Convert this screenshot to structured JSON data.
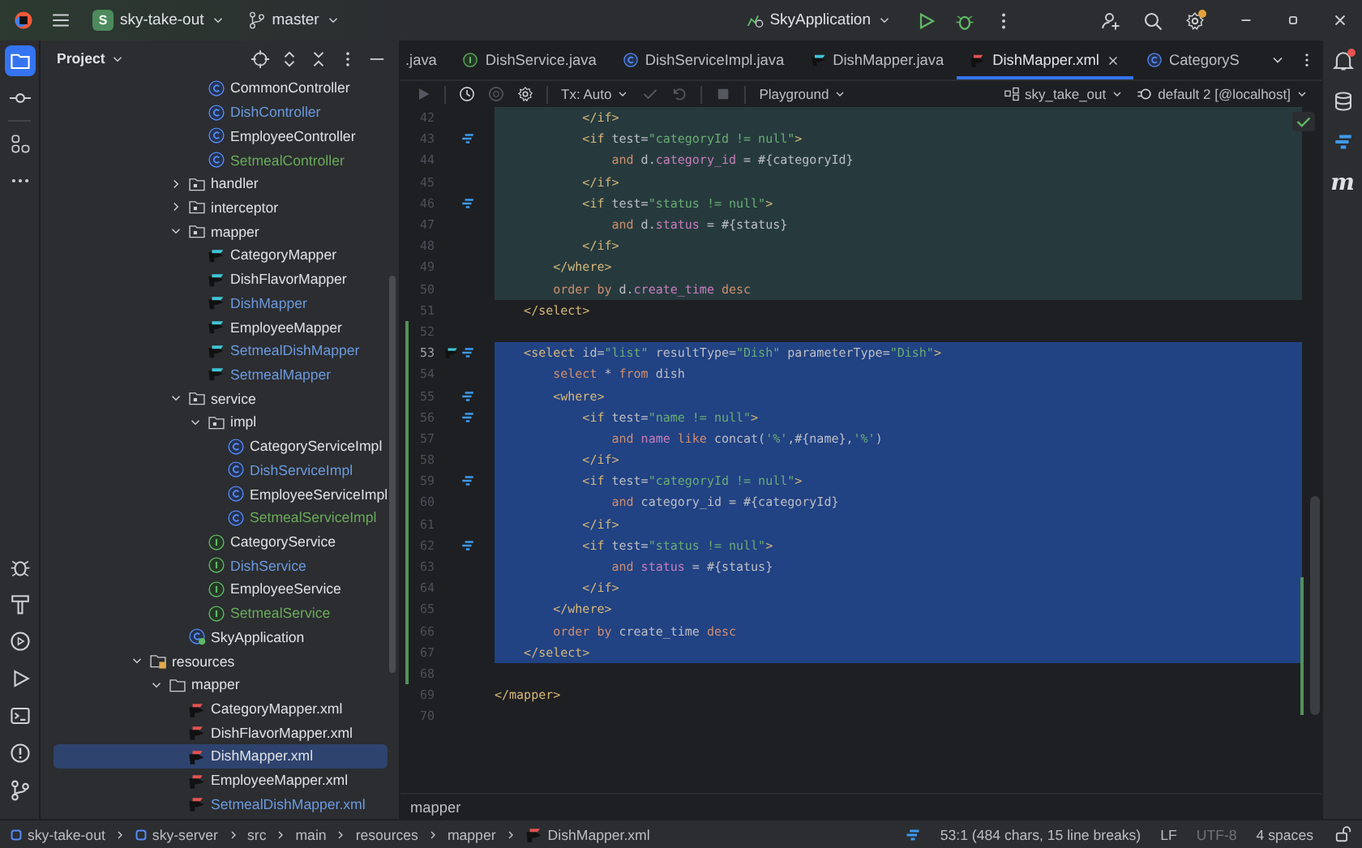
{
  "title_bar": {
    "project_badge": "S",
    "project": "sky-take-out",
    "branch": "master",
    "run_config": "SkyApplication",
    "settings_badge": true
  },
  "left_tools": [
    {
      "kind": "project",
      "selected": true
    },
    {
      "kind": "commit",
      "selected": false
    },
    {
      "kind": "structure",
      "selected": false
    },
    {
      "kind": "more",
      "selected": false
    }
  ],
  "left_tools_bottom": [
    {
      "kind": "debug"
    },
    {
      "kind": "build"
    },
    {
      "kind": "services"
    },
    {
      "kind": "run"
    },
    {
      "kind": "terminal"
    },
    {
      "kind": "problems"
    },
    {
      "kind": "git"
    }
  ],
  "project_panel": {
    "title": "Project",
    "tree": [
      {
        "children": [
          {
            "children": [
              {
                "children": [
                  {
                    "label": "CommonController",
                    "kind": "class",
                    "color": "#dfe1e5",
                    "selected": false
                  },
                  {
                    "label": "DishController",
                    "kind": "class",
                    "color": "#6b9ae0",
                    "selected": false
                  },
                  {
                    "label": "EmployeeController",
                    "kind": "class",
                    "color": "#dfe1e5",
                    "selected": false
                  },
                  {
                    "label": "SetmealController",
                    "kind": "class",
                    "color": "#6aab5b",
                    "selected": false
                  }
                ]
              },
              {
                "label": "handler",
                "kind": "package",
                "expanded": false,
                "selected": false
              },
              {
                "label": "interceptor",
                "kind": "package",
                "expanded": false,
                "selected": false
              },
              {
                "label": "mapper",
                "kind": "package",
                "expanded": true,
                "selected": false,
                "children": [
                  {
                    "label": "CategoryMapper",
                    "kind": "mapper",
                    "color": "#dfe1e5",
                    "selected": false
                  },
                  {
                    "label": "DishFlavorMapper",
                    "kind": "mapper",
                    "color": "#dfe1e5",
                    "selected": false
                  },
                  {
                    "label": "DishMapper",
                    "kind": "mapper",
                    "color": "#6b9ae0",
                    "selected": false
                  },
                  {
                    "label": "EmployeeMapper",
                    "kind": "mapper",
                    "color": "#dfe1e5",
                    "selected": false
                  },
                  {
                    "label": "SetmealDishMapper",
                    "kind": "mapper",
                    "color": "#6b9ae0",
                    "selected": false
                  },
                  {
                    "label": "SetmealMapper",
                    "kind": "mapper",
                    "color": "#6b9ae0",
                    "selected": false
                  }
                ]
              },
              {
                "label": "service",
                "kind": "package",
                "expanded": true,
                "selected": false,
                "children": [
                  {
                    "label": "impl",
                    "kind": "package",
                    "expanded": true,
                    "selected": false,
                    "children": [
                      {
                        "label": "CategoryServiceImpl",
                        "kind": "class",
                        "color": "#dfe1e5",
                        "selected": false
                      },
                      {
                        "label": "DishServiceImpl",
                        "kind": "class",
                        "color": "#6b9ae0",
                        "selected": false
                      },
                      {
                        "label": "EmployeeServiceImpl",
                        "kind": "class",
                        "color": "#dfe1e5",
                        "selected": false
                      },
                      {
                        "label": "SetmealServiceImpl",
                        "kind": "class",
                        "color": "#6aab5b",
                        "selected": false
                      }
                    ]
                  },
                  {
                    "label": "CategoryService",
                    "kind": "interface",
                    "color": "#dfe1e5",
                    "selected": false
                  },
                  {
                    "label": "DishService",
                    "kind": "interface",
                    "color": "#6b9ae0",
                    "selected": false
                  },
                  {
                    "label": "EmployeeService",
                    "kind": "interface",
                    "color": "#dfe1e5",
                    "selected": false
                  },
                  {
                    "label": "SetmealService",
                    "kind": "interface",
                    "color": "#6aab5b",
                    "selected": false
                  }
                ]
              },
              {
                "label": "SkyApplication",
                "kind": "application",
                "color": "#dfe1e5",
                "selected": false
              }
            ]
          }
        ]
      },
      {
        "label": "resources",
        "kind": "resources",
        "expanded": true,
        "selected": false,
        "children": [
          {
            "label": "mapper",
            "kind": "folder",
            "expanded": true,
            "selected": false,
            "children": [
              {
                "label": "CategoryMapper.xml",
                "kind": "xml",
                "color": "#dfe1e5",
                "selected": false
              },
              {
                "label": "DishFlavorMapper.xml",
                "kind": "xml",
                "color": "#dfe1e5",
                "selected": false
              },
              {
                "label": "DishMapper.xml",
                "kind": "xml",
                "color": "#dfe1e5",
                "selected": true
              },
              {
                "label": "EmployeeMapper.xml",
                "kind": "xml",
                "color": "#dfe1e5",
                "selected": false
              },
              {
                "label": "SetmealDishMapper.xml",
                "kind": "xml",
                "color": "#6b9ae0",
                "selected": false
              }
            ]
          }
        ]
      }
    ]
  },
  "editor": {
    "tabs": [
      {
        "label": ".java",
        "kind": "none",
        "selected": false
      },
      {
        "label": "DishService.java",
        "kind": "interface",
        "selected": false
      },
      {
        "label": "DishServiceImpl.java",
        "kind": "class",
        "selected": false
      },
      {
        "label": "DishMapper.java",
        "kind": "mapper",
        "selected": false
      },
      {
        "label": "DishMapper.xml",
        "kind": "xml",
        "selected": true
      },
      {
        "label": "CategoryS",
        "kind": "class",
        "selected": false
      }
    ],
    "toolbar": {
      "tx_mode": "Tx: Auto",
      "console": "Playground",
      "schema": "sky_take_out",
      "data_source": "default 2 [@localhost]"
    },
    "inspection_ok": true,
    "lines": [
      {
        "number": "42",
        "scope": true,
        "selected": false,
        "changed": false,
        "current": false,
        "segments": [
          {
            "kind": "tag",
            "text": "            </if>"
          }
        ]
      },
      {
        "number": "43",
        "scope": true,
        "selected": false,
        "changed": false,
        "current": false,
        "gutter": [
          {
            "kind": "mybatis"
          }
        ],
        "segments": [
          {
            "kind": "tag",
            "text": "            <if"
          },
          {
            "kind": "attr",
            "text": " test="
          },
          {
            "kind": "str",
            "text": "\"categoryId != null\""
          },
          {
            "kind": "tag",
            "text": ">"
          }
        ]
      },
      {
        "number": "44",
        "scope": true,
        "selected": false,
        "changed": false,
        "current": false,
        "segments": [
          {
            "kind": "kw",
            "text": "                and"
          },
          {
            "kind": "plain",
            "text": " d."
          },
          {
            "kind": "field",
            "text": "category_id"
          },
          {
            "kind": "plain",
            "text": " = #{categoryId}"
          }
        ]
      },
      {
        "number": "45",
        "scope": true,
        "selected": false,
        "changed": false,
        "current": false,
        "segments": [
          {
            "kind": "tag",
            "text": "            </if>"
          }
        ]
      },
      {
        "number": "46",
        "scope": true,
        "selected": false,
        "changed": false,
        "current": false,
        "gutter": [
          {
            "kind": "mybatis"
          }
        ],
        "segments": [
          {
            "kind": "tag",
            "text": "            <if"
          },
          {
            "kind": "attr",
            "text": " test="
          },
          {
            "kind": "str",
            "text": "\"status != null\""
          },
          {
            "kind": "tag",
            "text": ">"
          }
        ]
      },
      {
        "number": "47",
        "scope": true,
        "selected": false,
        "changed": false,
        "current": false,
        "segments": [
          {
            "kind": "kw",
            "text": "                and"
          },
          {
            "kind": "plain",
            "text": " d."
          },
          {
            "kind": "field",
            "text": "status"
          },
          {
            "kind": "plain",
            "text": " = #{status}"
          }
        ]
      },
      {
        "number": "48",
        "scope": true,
        "selected": false,
        "changed": false,
        "current": false,
        "segments": [
          {
            "kind": "tag",
            "text": "            </if>"
          }
        ]
      },
      {
        "number": "49",
        "scope": true,
        "selected": false,
        "changed": false,
        "current": false,
        "segments": [
          {
            "kind": "tag",
            "text": "        </where>"
          }
        ]
      },
      {
        "number": "50",
        "scope": true,
        "selected": false,
        "changed": false,
        "current": false,
        "segments": [
          {
            "kind": "kw",
            "text": "        order by"
          },
          {
            "kind": "plain",
            "text": " d."
          },
          {
            "kind": "field",
            "text": "create_time"
          },
          {
            "kind": "kw",
            "text": " desc"
          }
        ]
      },
      {
        "number": "51",
        "scope": false,
        "selected": false,
        "changed": false,
        "current": false,
        "segments": [
          {
            "kind": "tag",
            "text": "    </select>"
          }
        ]
      },
      {
        "number": "52",
        "scope": false,
        "selected": false,
        "changed": true,
        "current": false
      },
      {
        "number": "53",
        "scope": false,
        "selected": true,
        "changed": true,
        "current": true,
        "gutter": [
          {
            "kind": "mapper"
          },
          {
            "kind": "mybatis"
          }
        ],
        "segments": [
          {
            "kind": "tag",
            "text": "    <select"
          },
          {
            "kind": "attr",
            "text": " id="
          },
          {
            "kind": "str",
            "text": "\"list\""
          },
          {
            "kind": "attr",
            "text": " resultType="
          },
          {
            "kind": "str",
            "text": "\"Dish\""
          },
          {
            "kind": "attr",
            "text": " parameterType="
          },
          {
            "kind": "str",
            "text": "\"Dish\""
          },
          {
            "kind": "tag",
            "text": ">"
          }
        ]
      },
      {
        "number": "54",
        "scope": false,
        "selected": true,
        "changed": true,
        "current": false,
        "segments": [
          {
            "kind": "kw",
            "text": "        select"
          },
          {
            "kind": "plain",
            "text": " * "
          },
          {
            "kind": "kw",
            "text": "from"
          },
          {
            "kind": "plain",
            "text": " dish"
          }
        ]
      },
      {
        "number": "55",
        "scope": false,
        "selected": true,
        "changed": true,
        "current": false,
        "gutter": [
          {
            "kind": "mybatis"
          }
        ],
        "segments": [
          {
            "kind": "tag",
            "text": "        <where>"
          }
        ]
      },
      {
        "number": "56",
        "scope": false,
        "selected": true,
        "changed": true,
        "current": false,
        "gutter": [
          {
            "kind": "mybatis"
          }
        ],
        "segments": [
          {
            "kind": "tag",
            "text": "            <if"
          },
          {
            "kind": "attr",
            "text": " test="
          },
          {
            "kind": "str",
            "text": "\"name != null\""
          },
          {
            "kind": "tag",
            "text": ">"
          }
        ]
      },
      {
        "number": "57",
        "scope": false,
        "selected": true,
        "changed": true,
        "current": false,
        "segments": [
          {
            "kind": "kw",
            "text": "                and"
          },
          {
            "kind": "field",
            "text": " name"
          },
          {
            "kind": "kw",
            "text": " like"
          },
          {
            "kind": "plain",
            "text": " concat("
          },
          {
            "kind": "str",
            "text": "'%'"
          },
          {
            "kind": "plain",
            "text": ",#{name},"
          },
          {
            "kind": "str",
            "text": "'%'"
          },
          {
            "kind": "plain",
            "text": ")"
          }
        ]
      },
      {
        "number": "58",
        "scope": false,
        "selected": true,
        "changed": true,
        "current": false,
        "segments": [
          {
            "kind": "tag",
            "text": "            </if>"
          }
        ]
      },
      {
        "number": "59",
        "scope": false,
        "selected": true,
        "changed": true,
        "current": false,
        "gutter": [
          {
            "kind": "mybatis"
          }
        ],
        "segments": [
          {
            "kind": "tag",
            "text": "            <if"
          },
          {
            "kind": "attr",
            "text": " test="
          },
          {
            "kind": "str",
            "text": "\"categoryId != null\""
          },
          {
            "kind": "tag",
            "text": ">"
          }
        ]
      },
      {
        "number": "60",
        "scope": false,
        "selected": true,
        "changed": true,
        "current": false,
        "segments": [
          {
            "kind": "kw",
            "text": "                and"
          },
          {
            "kind": "plain",
            "text": " category_id = #{categoryId}"
          }
        ]
      },
      {
        "number": "61",
        "scope": false,
        "selected": true,
        "changed": true,
        "current": false,
        "segments": [
          {
            "kind": "tag",
            "text": "            </if>"
          }
        ]
      },
      {
        "number": "62",
        "scope": false,
        "selected": true,
        "changed": true,
        "current": false,
        "gutter": [
          {
            "kind": "mybatis"
          }
        ],
        "segments": [
          {
            "kind": "tag",
            "text": "            <if"
          },
          {
            "kind": "attr",
            "text": " test="
          },
          {
            "kind": "str",
            "text": "\"status != null\""
          },
          {
            "kind": "tag",
            "text": ">"
          }
        ]
      },
      {
        "number": "63",
        "scope": false,
        "selected": true,
        "changed": true,
        "current": false,
        "segments": [
          {
            "kind": "kw",
            "text": "                and"
          },
          {
            "kind": "field",
            "text": " status"
          },
          {
            "kind": "plain",
            "text": " = #{status}"
          }
        ]
      },
      {
        "number": "64",
        "scope": false,
        "selected": true,
        "changed": true,
        "current": false,
        "segments": [
          {
            "kind": "tag",
            "text": "            </if>"
          }
        ]
      },
      {
        "number": "65",
        "scope": false,
        "selected": true,
        "changed": true,
        "current": false,
        "segments": [
          {
            "kind": "tag",
            "text": "        </where>"
          }
        ]
      },
      {
        "number": "66",
        "scope": false,
        "selected": true,
        "changed": true,
        "current": false,
        "segments": [
          {
            "kind": "kw",
            "text": "        order by"
          },
          {
            "kind": "plain",
            "text": " create_time "
          },
          {
            "kind": "kw",
            "text": "desc"
          }
        ]
      },
      {
        "number": "67",
        "scope": false,
        "selected": true,
        "changed": true,
        "current": false,
        "segments": [
          {
            "kind": "tag",
            "text": "    </select>"
          }
        ]
      },
      {
        "number": "68",
        "scope": false,
        "selected": false,
        "changed": true,
        "current": false
      },
      {
        "number": "69",
        "scope": false,
        "selected": false,
        "changed": false,
        "current": false,
        "segments": [
          {
            "kind": "tag",
            "text": "</mapper>"
          }
        ]
      },
      {
        "number": "70",
        "scope": false,
        "selected": false,
        "changed": false,
        "current": false
      }
    ],
    "breadcrumb": "mapper"
  },
  "right_tools": [
    {
      "kind": "notifications",
      "badge": true
    },
    {
      "kind": "database"
    },
    {
      "kind": "mybatis"
    },
    {
      "kind": "maven",
      "glyph": "m"
    }
  ],
  "status_bar": {
    "path": [
      {
        "kind": "module",
        "label": "sky-take-out"
      },
      {
        "kind": "module",
        "label": "sky-server"
      },
      {
        "kind": "none",
        "label": "src"
      },
      {
        "kind": "none",
        "label": "main"
      },
      {
        "kind": "none",
        "label": "resources"
      },
      {
        "kind": "none",
        "label": "mapper"
      },
      {
        "kind": "xml",
        "label": "DishMapper.xml"
      }
    ],
    "position": "53:1 (484 chars, 15 line breaks)",
    "line_separator": "LF",
    "encoding": "UTF-8",
    "indent": "4 spaces"
  }
}
